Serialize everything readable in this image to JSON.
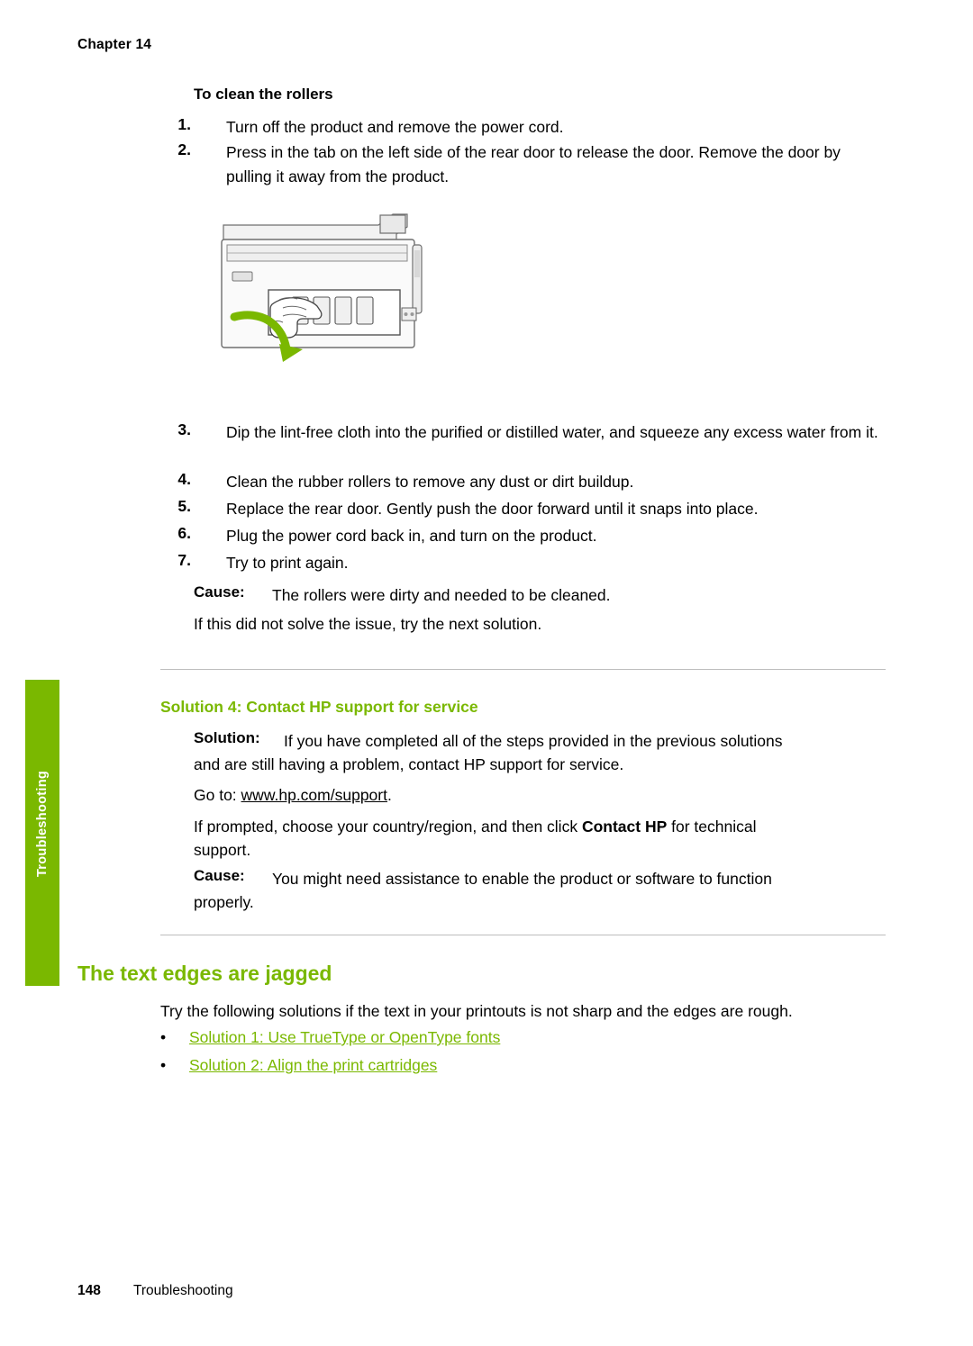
{
  "header": {
    "chapter": "Chapter 14"
  },
  "side_tab": {
    "label": "Troubleshooting",
    "color": "#7ab800"
  },
  "section": {
    "clean_rollers_title": "To clean the rollers",
    "steps": [
      {
        "num": "1.",
        "text": "Turn off the product and remove the power cord."
      },
      {
        "num": "2.",
        "text": "Press in the tab on the left side of the rear door to release the door. Remove the door by pulling it away from the product."
      },
      {
        "num": "3.",
        "text": "Dip the lint-free cloth into the purified or distilled water, and squeeze any excess water from it."
      },
      {
        "num": "4.",
        "text": "Clean the rubber rollers to remove any dust or dirt buildup."
      },
      {
        "num": "5.",
        "text": "Replace the rear door. Gently push the door forward until it snaps into place."
      },
      {
        "num": "6.",
        "text": "Plug the power cord back in, and turn on the product."
      },
      {
        "num": "7.",
        "text": "Try to print again."
      }
    ],
    "cause_label_1": "Cause:",
    "cause_text_1": "The rollers were dirty and needed to be cleaned.",
    "next_solution_1": "If this did not solve the issue, try the next solution."
  },
  "solution4": {
    "heading": "Solution 4: Contact HP support for service",
    "solution_label": "Solution:",
    "solution_text_line1": "If you have completed all of the steps provided in the previous solutions",
    "solution_text_line2": "and are still having a problem, contact HP support for service.",
    "goto_prefix": "Go to:",
    "goto_link": "www.hp.com/support",
    "goto_suffix": ".",
    "prompt_line1_a": "If prompted, choose your country/region, and then click ",
    "prompt_bold": "Contact HP",
    "prompt_line1_b": " for technical",
    "prompt_line2": "support.",
    "cause_label": "Cause:",
    "cause_text_line1": "You might need assistance to enable the product or software to function",
    "cause_text_line2": "properly."
  },
  "jagged": {
    "heading": "The text edges are jagged",
    "intro": "Try the following solutions if the text in your printouts is not sharp and the edges are rough.",
    "links": [
      {
        "bullet": "•",
        "text": "Solution 1: Use TrueType or OpenType fonts"
      },
      {
        "bullet": "•",
        "text": "Solution 2: Align the print cartridges"
      }
    ]
  },
  "footer": {
    "page_number": "148",
    "page_label": "Troubleshooting"
  },
  "figure": {
    "name": "printer-rear-door-illustration",
    "arrow_color": "#7ab800"
  }
}
